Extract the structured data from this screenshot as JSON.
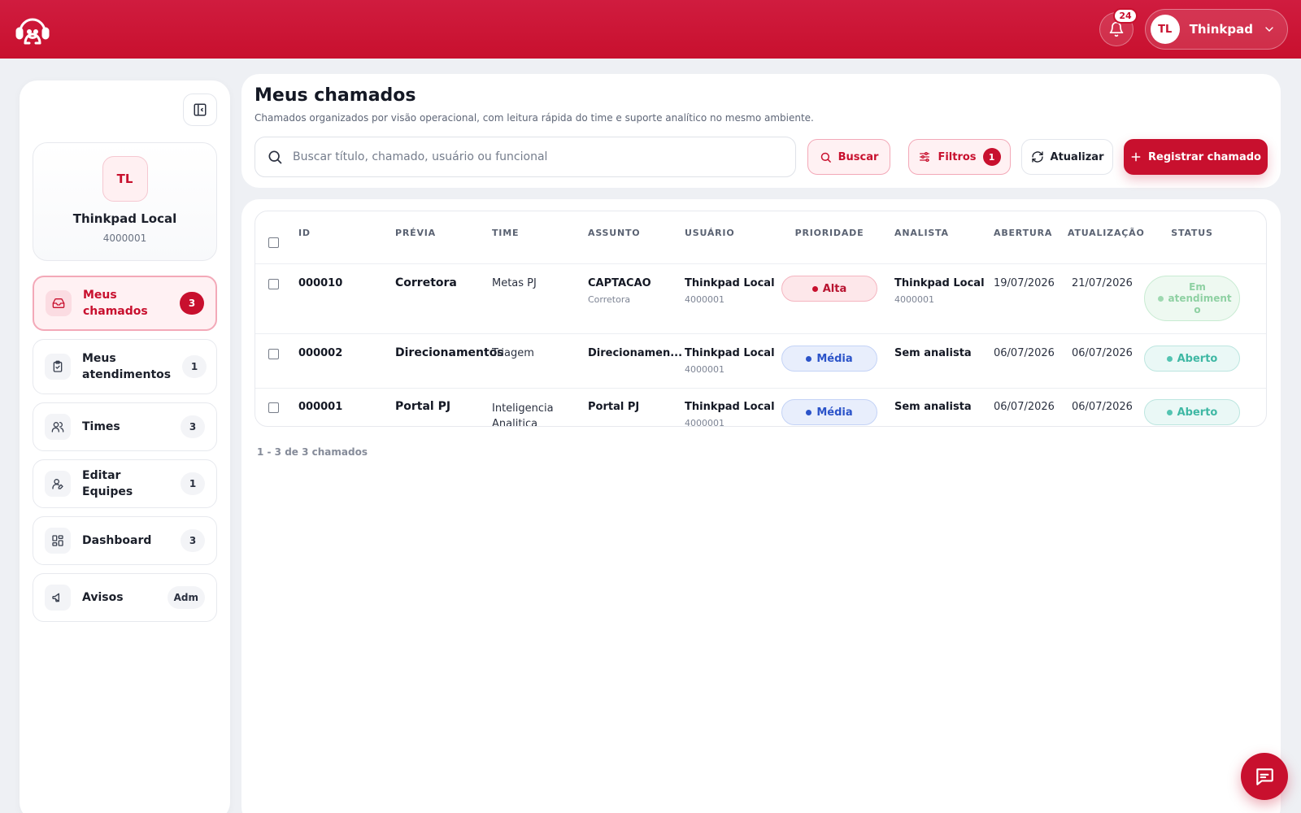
{
  "header": {
    "notifications_count": "24",
    "user_initials": "TL",
    "user_name": "Thinkpad"
  },
  "sidebar": {
    "profile": {
      "initials": "TL",
      "name": "Thinkpad Local",
      "id": "4000001"
    },
    "items": [
      {
        "label": "Meus chamados",
        "count": "3",
        "icon": "inbox-icon",
        "active": true
      },
      {
        "label": "Meus atendimentos",
        "count": "1",
        "icon": "clipboard-check-icon",
        "active": false
      },
      {
        "label": "Times",
        "count": "3",
        "icon": "users-icon",
        "active": false
      },
      {
        "label": "Editar Equipes",
        "count": "1",
        "icon": "user-edit-icon",
        "active": false
      },
      {
        "label": "Dashboard",
        "count": "3",
        "icon": "dashboard-grid-icon",
        "active": false
      },
      {
        "label": "Avisos",
        "count": "Adm",
        "icon": "megaphone-icon",
        "active": false
      }
    ]
  },
  "page": {
    "title": "Meus chamados",
    "subtitle": "Chamados organizados por visão operacional, com leitura rápida do time e suporte analítico no mesmo ambiente.",
    "search_placeholder": "Buscar título, chamado, usuário ou funcional",
    "search_button": "Buscar",
    "filter_button": "Filtros",
    "filter_count": "1",
    "refresh_button": "Atualizar",
    "register_button": "Registrar chamado"
  },
  "table": {
    "columns": [
      "ID",
      "PRÉVIA",
      "TIME",
      "ASSUNTO",
      "USUÁRIO",
      "PRIORIDADE",
      "ANALISTA",
      "ABERTURA",
      "ATUALIZAÇÃO",
      "STATUS"
    ],
    "rows": [
      {
        "id": "000010",
        "preview": "Corretora",
        "team": "Metas PJ",
        "subject": "CAPTACAO",
        "subject_sub": "Corretora",
        "user": "Thinkpad Local",
        "user_id": "4000001",
        "priority": "Alta",
        "analyst": "Thinkpad Local",
        "analyst_id": "4000001",
        "opened": "19/07/2026",
        "updated": "21/07/2026",
        "status": "Em atendiment o"
      },
      {
        "id": "000002",
        "preview": "Direcionamentos",
        "team": "Triagem",
        "subject": "Direcionamen...",
        "subject_sub": "",
        "user": "Thinkpad Local",
        "user_id": "4000001",
        "priority": "Média",
        "analyst": "Sem analista",
        "analyst_id": "",
        "opened": "06/07/2026",
        "updated": "06/07/2026",
        "status": "Aberto"
      },
      {
        "id": "000001",
        "preview": "Portal PJ",
        "team": "Inteligencia Analitica",
        "subject": "Portal PJ",
        "subject_sub": "",
        "user": "Thinkpad Local",
        "user_id": "4000001",
        "priority": "Média",
        "analyst": "Sem analista",
        "analyst_id": "",
        "opened": "06/07/2026",
        "updated": "06/07/2026",
        "status": "Aberto"
      }
    ]
  },
  "pagination": "1 - 3 de 3 chamados",
  "colors": {
    "brand": "#c8102e",
    "priority_high": "#c8102e",
    "priority_medium": "#2b53c9",
    "status_open": "#3fb8a4"
  }
}
